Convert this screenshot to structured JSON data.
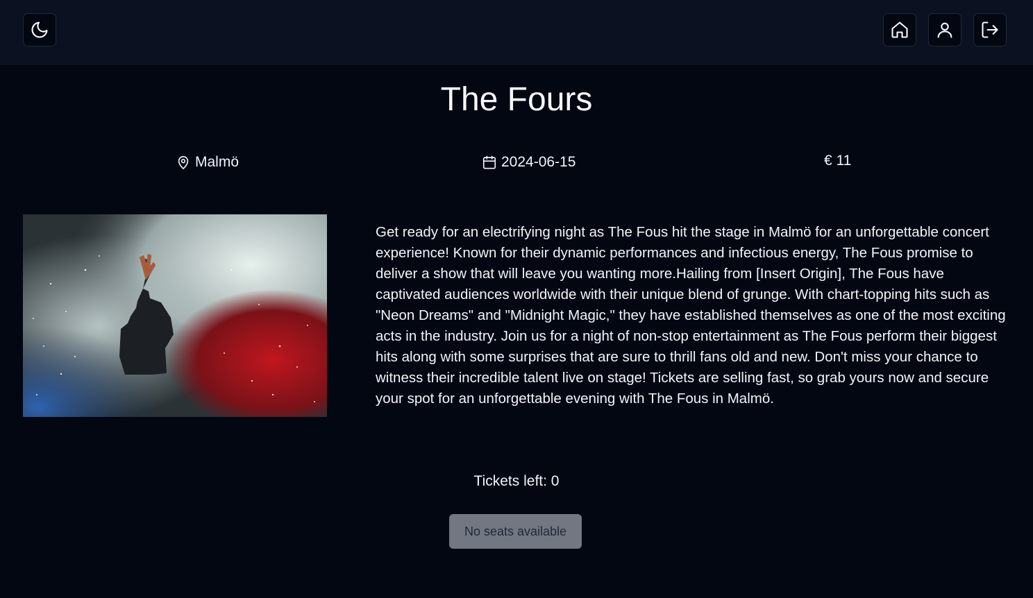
{
  "header": {
    "theme_toggle_icon": "moon-icon",
    "nav": [
      {
        "icon": "home-icon"
      },
      {
        "icon": "user-icon"
      },
      {
        "icon": "logout-icon"
      }
    ]
  },
  "event": {
    "title": "The Fours",
    "location": "Malmö",
    "date": "2024-06-15",
    "price": "€ 11",
    "description": "Get ready for an electrifying night as The Fous hit the stage in Malmö for an unforgettable concert experience! Known for their dynamic performances and infectious energy, The Fous promise to deliver a show that will leave you wanting more.Hailing from [Insert Origin], The Fous have captivated audiences worldwide with their unique blend of grunge. With chart-topping hits such as \"Neon Dreams\" and \"Midnight Magic,\" they have established themselves as one of the most exciting acts in the industry. Join us for a night of non-stop entertainment as The Fous perform their biggest hits along with some surprises that are sure to thrill fans old and new. Don't miss your chance to witness their incredible talent live on stage! Tickets are selling fast, so grab yours now and secure your spot for an unforgettable evening with The Fous in Malmö.",
    "tickets_left": "Tickets left: 0",
    "no_seats_label": "No seats available"
  },
  "colors": {
    "background": "#030712",
    "topbar": "#0b1120",
    "disabled_button": "#737782"
  }
}
